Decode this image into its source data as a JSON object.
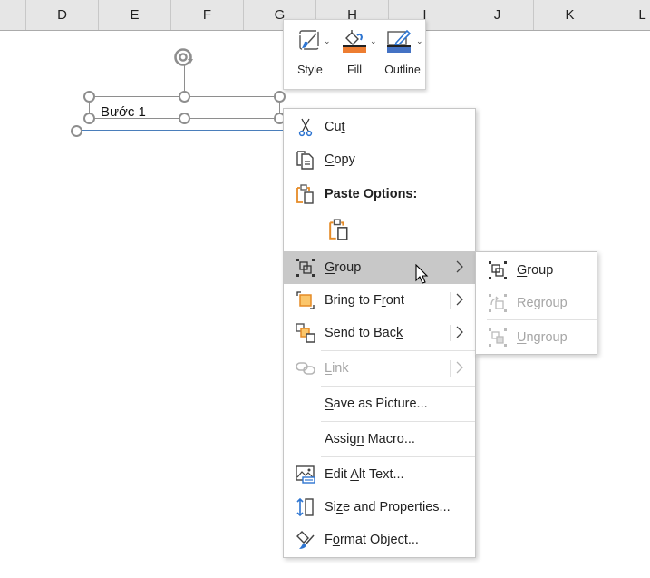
{
  "columns": [
    "D",
    "E",
    "F",
    "G",
    "H",
    "I",
    "J",
    "K",
    "L"
  ],
  "shape": {
    "text": "Bước 1",
    "connector_color": "#4a7ebb"
  },
  "mini_toolbar": {
    "buttons": [
      {
        "id": "style",
        "label": "Style",
        "icon": "shape-style-icon"
      },
      {
        "id": "fill",
        "label": "Fill",
        "icon": "paint-bucket-icon",
        "swatch_color": "#ed7d31"
      },
      {
        "id": "outline",
        "label": "Outline",
        "icon": "pencil-outline-icon",
        "swatch_color": "#4472c4"
      }
    ]
  },
  "context_menu": {
    "items": [
      {
        "id": "cut",
        "pre": "Cu",
        "ul": "t",
        "post": "",
        "icon": "scissors-icon"
      },
      {
        "id": "copy",
        "pre": "",
        "ul": "C",
        "post": "opy",
        "icon": "copy-icon"
      },
      {
        "id": "paste-options",
        "label": "Paste Options:",
        "icon": "paste-icon",
        "header": true
      },
      {
        "id": "paste-keep",
        "icon": "paste-icon"
      },
      {
        "id": "group",
        "pre": "",
        "ul": "G",
        "post": "roup",
        "icon": "group-icon",
        "submenu": true,
        "hover": true
      },
      {
        "id": "bring-to-front",
        "pre": "Bring to F",
        "ul": "r",
        "post": "ont",
        "icon": "bring-to-front-icon",
        "submenu": true
      },
      {
        "id": "send-to-back",
        "pre": "Send to Bac",
        "ul": "k",
        "post": "",
        "icon": "send-to-back-icon",
        "submenu": true
      },
      {
        "id": "link",
        "pre": "",
        "ul": "L",
        "post": "ink",
        "icon": "link-icon",
        "submenu": true,
        "disabled": true
      },
      {
        "id": "save-as-picture",
        "pre": "",
        "ul": "S",
        "post": "ave as Picture...",
        "icon": ""
      },
      {
        "id": "assign-macro",
        "pre": "Assig",
        "ul": "n",
        "post": " Macro...",
        "icon": ""
      },
      {
        "id": "edit-alt-text",
        "pre": "Edit ",
        "ul": "A",
        "post": "lt Text...",
        "icon": "alt-text-icon"
      },
      {
        "id": "size-and-properties",
        "pre": "Si",
        "ul": "z",
        "post": "e and Properties...",
        "icon": "size-properties-icon"
      },
      {
        "id": "format-object",
        "pre": "F",
        "ul": "o",
        "post": "rmat Object...",
        "icon": "format-object-icon"
      }
    ]
  },
  "group_submenu": {
    "items": [
      {
        "id": "sub-group",
        "pre": "",
        "ul": "G",
        "post": "roup",
        "icon": "group-icon",
        "disabled": false
      },
      {
        "id": "sub-regroup",
        "pre": "R",
        "ul": "e",
        "post": "group",
        "icon": "regroup-icon",
        "disabled": true
      },
      {
        "id": "sub-ungroup",
        "pre": "",
        "ul": "U",
        "post": "ngroup",
        "icon": "ungroup-icon",
        "disabled": true
      }
    ]
  }
}
